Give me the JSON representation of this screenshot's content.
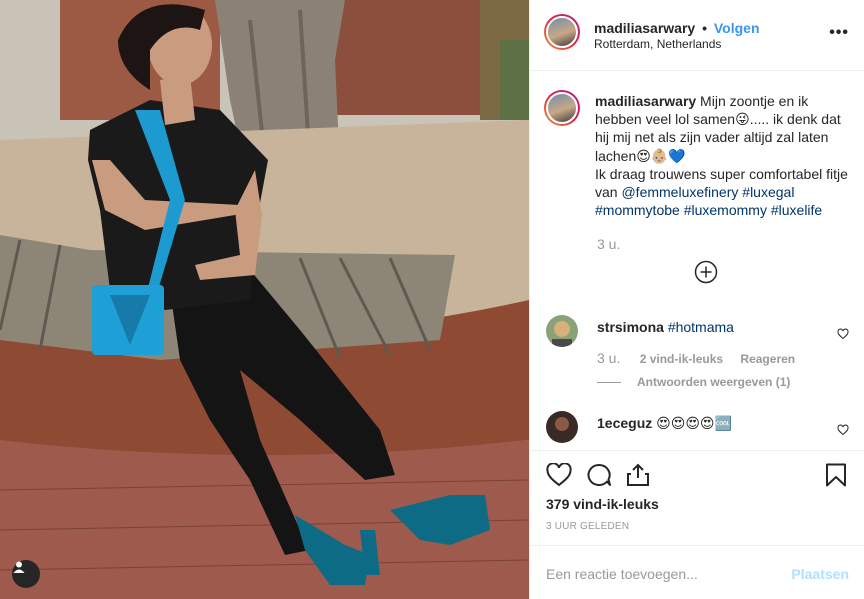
{
  "post": {
    "username": "madiliasarwary",
    "follow_label": "Volgen",
    "separator": "•",
    "location": "Rotterdam, Netherlands",
    "more_label": "•••"
  },
  "caption": {
    "username": "madiliasarwary",
    "line1": " Mijn zoontje en ik hebben veel lol samen😜..... ik denk dat hij mij net als zijn vader altijd zal laten lachen😍👶🏼💙",
    "line2": "Ik draag trouwens super comfortabel fitje van ",
    "mention": "@femmeluxefinery",
    "space": " ",
    "tag1": "#luxegal",
    "tag2": "#mommytobe",
    "tag3": "#luxemommy",
    "tag4": "#luxelife",
    "time": "3 u."
  },
  "comments": [
    {
      "username": "strsimona",
      "text": "#hotmama",
      "time": "3 u.",
      "likes": "2 vind-ik-leuks",
      "reply": "Reageren",
      "view_replies": "Antwoorden weergeven (1)"
    },
    {
      "username": "1eceguz",
      "text": "😍😍😍😍🆒"
    }
  ],
  "stats": {
    "likes": "379 vind-ik-leuks",
    "date": "3 UUR GELEDEN"
  },
  "add_comment": {
    "placeholder": "Een reactie toevoegen...",
    "post_label": "Plaatsen"
  },
  "colors": {
    "accent": "#3897f0",
    "hashtag": "#003569",
    "muted": "#999999"
  }
}
